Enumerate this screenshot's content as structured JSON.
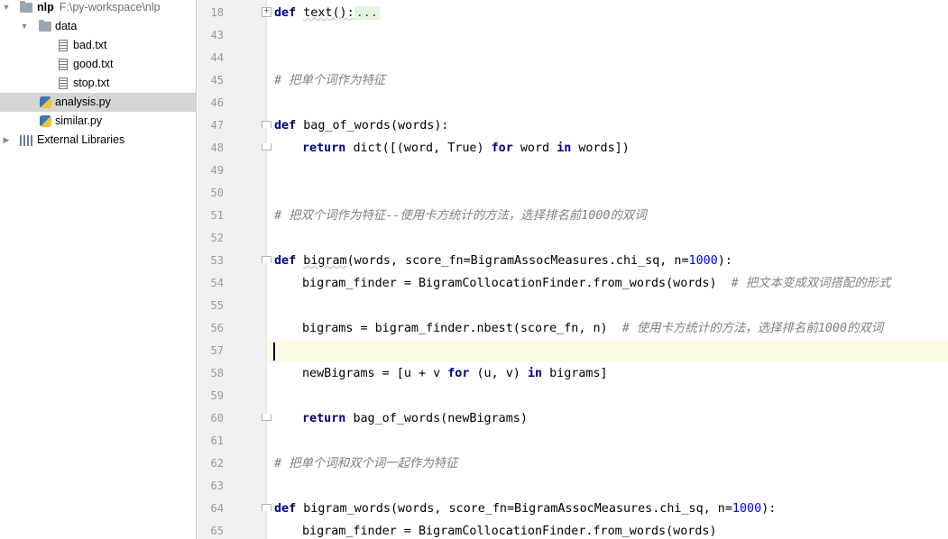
{
  "project_tree": {
    "root": {
      "name": "nlp",
      "path": "F:\\py-workspace\\nlp"
    },
    "data_folder": "data",
    "data_files": [
      "bad.txt",
      "good.txt",
      "stop.txt"
    ],
    "files": [
      "analysis.py",
      "similar.py"
    ],
    "selected_file": "analysis.py",
    "external_libraries": "External Libraries",
    "icons": {
      "folder": "folder-icon",
      "text_file": "text-file-icon",
      "python_file": "python-file-icon",
      "library": "library-icon"
    }
  },
  "editor": {
    "current_line": "57",
    "colors": {
      "keyword": "#000080",
      "comment": "#808080",
      "number": "#0000ff",
      "current_line_bg": "#fdfbe6"
    },
    "lines": [
      {
        "num": "18"
      },
      {
        "num": "43"
      },
      {
        "num": "44"
      },
      {
        "num": "45",
        "comment": "# 把单个词作为特征"
      },
      {
        "num": "46"
      },
      {
        "num": "47",
        "kw": "def",
        "text": "bag_of_words(words):"
      },
      {
        "num": "48",
        "kw": "return",
        "text": "dict([(word, True)",
        "kw2": "for",
        "text2": "word",
        "kw3": "in",
        "text3": "words])"
      },
      {
        "num": "49"
      },
      {
        "num": "50"
      },
      {
        "num": "51",
        "comment": "# 把双个词作为特征--使用卡方统计的方法，选择排名前1000的双词"
      },
      {
        "num": "52"
      },
      {
        "num": "53",
        "kw": "def",
        "fname": "bigram",
        "text": "(words, score_fn=BigramAssocMeasures.chi_sq, n=",
        "number": "1000",
        "text2": "):"
      },
      {
        "num": "54",
        "text": "bigram_finder = BigramCollocationFinder.from_words(words)",
        "comment": "# 把文本变成双词搭配的形式"
      },
      {
        "num": "55"
      },
      {
        "num": "56",
        "text": "bigrams = bigram_finder.nbest(score_fn, n)",
        "comment": "# 使用卡方统计的方法，选择排名前1000的双词"
      },
      {
        "num": "57"
      },
      {
        "num": "58",
        "text": "newBigrams = [u + v",
        "kw": "for",
        "text2": "(u, v)",
        "kw2": "in",
        "text3": "bigrams]"
      },
      {
        "num": "59"
      },
      {
        "num": "60",
        "kw": "return",
        "text": "bag_of_words(newBigrams)"
      },
      {
        "num": "61"
      },
      {
        "num": "62",
        "comment": "# 把单个词和双个词一起作为特征"
      },
      {
        "num": "63"
      },
      {
        "num": "64",
        "kw": "def",
        "text": "bigram_words(words, score_fn=BigramAssocMeasures.chi_sq, n=",
        "number": "1000",
        "text2": "):"
      },
      {
        "num": "65",
        "text": "bigram_finder = BigramCollocationFinder.from_words(words)"
      }
    ],
    "line18": {
      "kw": "def",
      "text": "text():",
      "folded": "..."
    }
  }
}
